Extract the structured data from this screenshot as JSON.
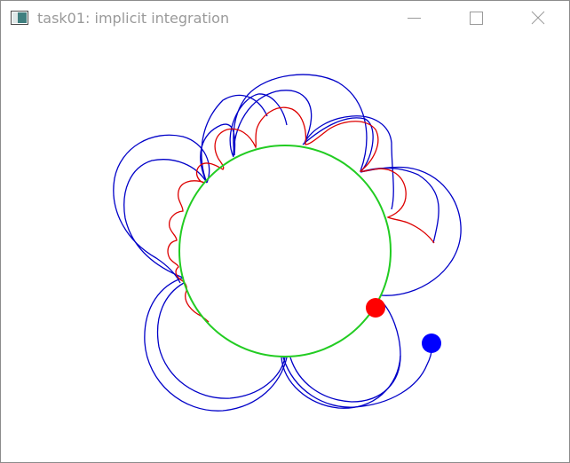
{
  "window": {
    "title": "task01: implicit integration",
    "icons": {
      "app": "app-window-icon",
      "minimize": "minimize-icon",
      "maximize": "maximize-icon",
      "close": "close-icon"
    }
  },
  "colors": {
    "circle": "#22cc22",
    "blue_path": "#0000c8",
    "red_path": "#dd0000",
    "red_ball": "#ff0000",
    "blue_ball": "#0000ff",
    "title_text": "#9a9a9a"
  }
}
